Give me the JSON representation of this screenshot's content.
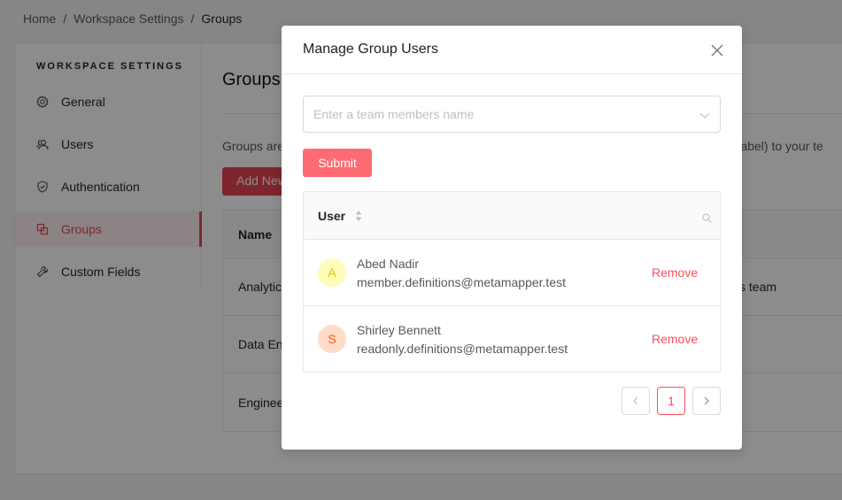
{
  "breadcrumb": [
    "Home",
    "Workspace Settings",
    "Groups"
  ],
  "sidebar": {
    "title": "WORKSPACE SETTINGS",
    "items": [
      {
        "label": "General",
        "icon": "gear-icon"
      },
      {
        "label": "Users",
        "icon": "users-icon"
      },
      {
        "label": "Authentication",
        "icon": "shield-icon"
      },
      {
        "label": "Groups",
        "icon": "groups-icon",
        "active": true
      },
      {
        "label": "Custom Fields",
        "icon": "wrench-icon"
      }
    ]
  },
  "content": {
    "title": "Groups",
    "description_start": "Groups are",
    "description_end": "er label) to your te",
    "add_button": "Add New",
    "table": {
      "header": "Name",
      "rows": [
        "Analytics",
        "Data Engineering",
        "Engineering"
      ],
      "row1_tail": "s team"
    }
  },
  "modal": {
    "title": "Manage Group Users",
    "select_placeholder": "Enter a team members name",
    "submit": "Submit",
    "table": {
      "header": "User",
      "rows": [
        {
          "initial": "A",
          "name": "Abed Nadir",
          "email": "member.definitions@metamapper.test",
          "action": "Remove",
          "avatar_bg": "#fffbb8",
          "avatar_fg": "#e6c200"
        },
        {
          "initial": "S",
          "name": "Shirley Bennett",
          "email": "readonly.definitions@metamapper.test",
          "action": "Remove",
          "avatar_bg": "#ffdcc7",
          "avatar_fg": "#fa541c"
        }
      ]
    },
    "pagination": {
      "current": "1"
    }
  },
  "colors": {
    "accent": "#ff6b72",
    "danger": "#ff4d5a"
  }
}
